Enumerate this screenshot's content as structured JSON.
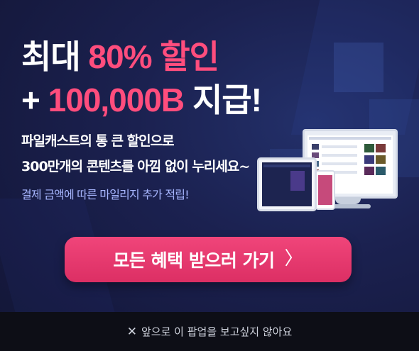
{
  "headline": {
    "line1_prefix": "최대",
    "line1_highlight": "80% 할인",
    "line2_prefix": "+",
    "line2_highlight": "100,000B",
    "line2_suffix": "지급!"
  },
  "subtext": {
    "line1": "파일캐스트의 통 큰 할인으로",
    "line2": "300만개의 콘텐츠를 아낌 없이 누리세요~"
  },
  "note": "결제 금액에 따른 마일리지 추가 적립!",
  "cta": {
    "label": "모든 혜택 받으러 가기",
    "arrow": "〉"
  },
  "footer": {
    "close_icon": "✕",
    "label": "앞으로 이 팝업을 보고싶지 않아요"
  },
  "colors": {
    "accent_pink": "#ff4d7d",
    "button": "#e8356d",
    "background": "#1b2150",
    "footer_bg": "#0d0e16"
  }
}
